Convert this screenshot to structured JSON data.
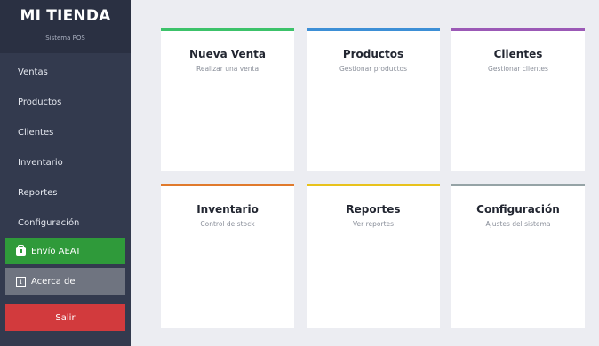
{
  "brand": {
    "title": "MI TIENDA",
    "subtitle": "Sistema POS"
  },
  "sidebar": {
    "items": [
      {
        "label": "Ventas"
      },
      {
        "label": "Productos"
      },
      {
        "label": "Clientes"
      },
      {
        "label": "Inventario"
      },
      {
        "label": "Reportes"
      },
      {
        "label": "Configuración"
      }
    ],
    "aeat_label": "Envío AEAT",
    "aeat_icon": "clipboard-icon",
    "about_label": "Acerca de",
    "about_icon": "info-icon",
    "exit_label": "Salir"
  },
  "colors": {
    "sidebar_bg": "#333a4e",
    "aeat_green": "#2f9a3a",
    "about_gray": "#6f7480",
    "exit_red": "#d23a3d"
  },
  "cards": [
    {
      "title": "Nueva Venta",
      "description": "Realizar una venta",
      "accent": "#3cc26a"
    },
    {
      "title": "Productos",
      "description": "Gestionar productos",
      "accent": "#3d8fd6"
    },
    {
      "title": "Clientes",
      "description": "Gestionar clientes",
      "accent": "#9b59b6"
    },
    {
      "title": "Inventario",
      "description": "Control de stock",
      "accent": "#e07a2c"
    },
    {
      "title": "Reportes",
      "description": "Ver reportes",
      "accent": "#e8c21c"
    },
    {
      "title": "Configuración",
      "description": "Ajustes del sistema",
      "accent": "#95a3a6"
    }
  ]
}
